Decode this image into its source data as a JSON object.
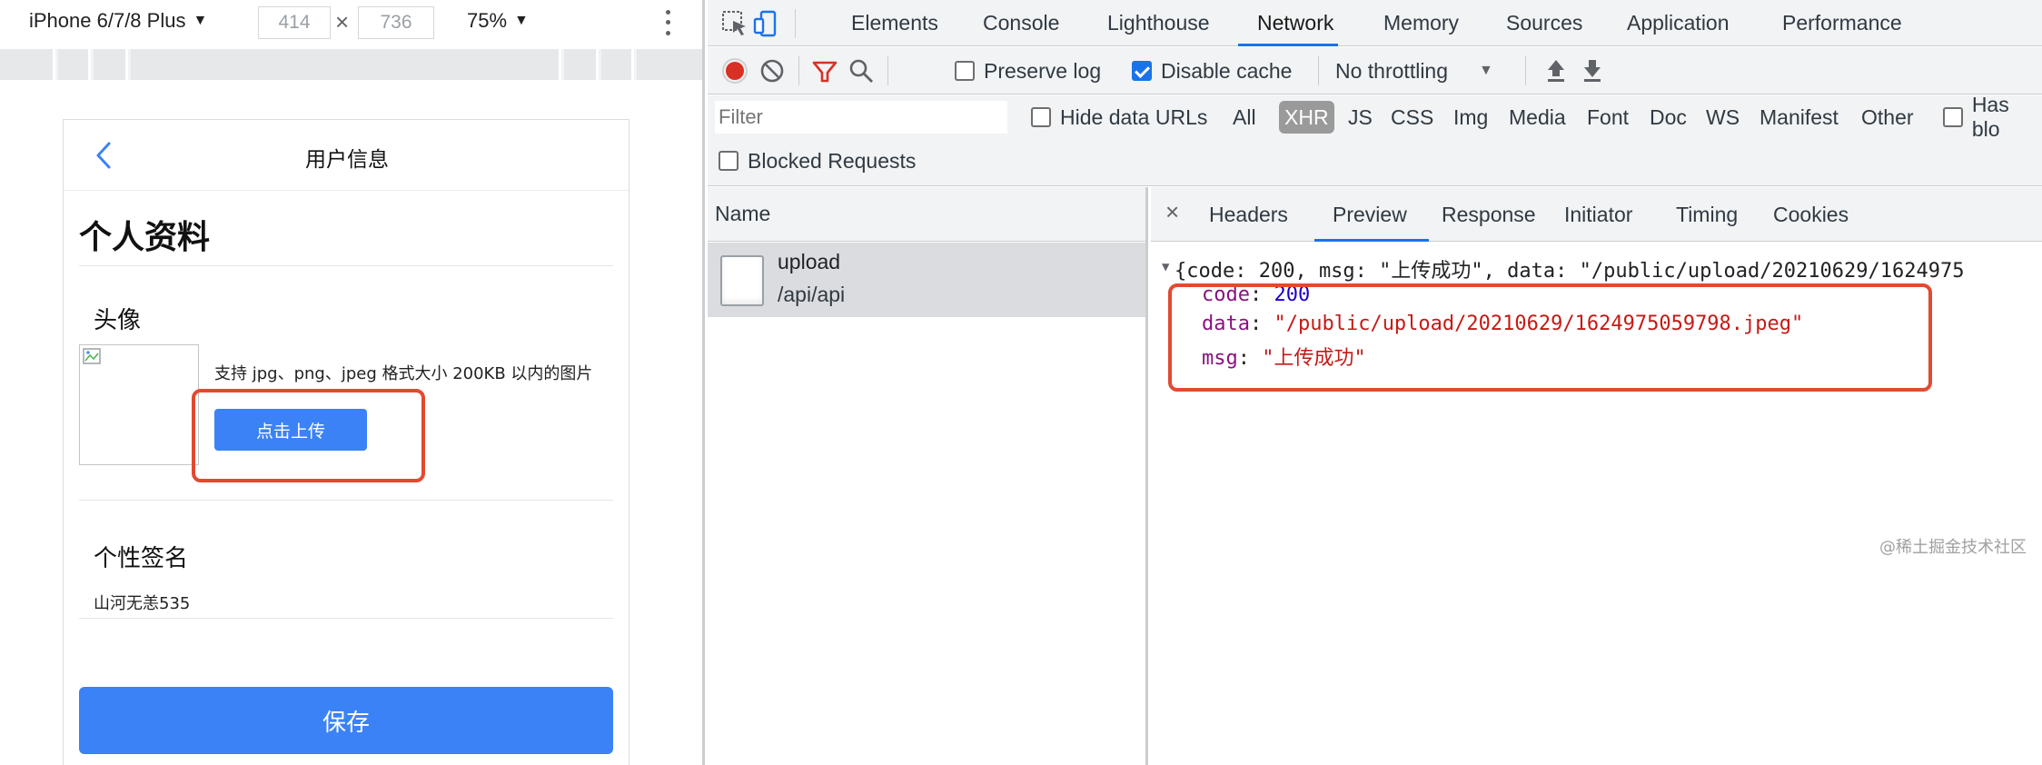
{
  "device_toolbar": {
    "device": "iPhone 6/7/8 Plus",
    "width": "414",
    "height": "736",
    "zoom": "75%"
  },
  "phone": {
    "nav_title": "用户信息",
    "section_title": "个人资料",
    "avatar_label": "头像",
    "upload_hint": "支持 jpg、png、jpeg 格式大小 200KB 以内的图片",
    "upload_button": "点击上传",
    "signature_label": "个性签名",
    "signature_value": "山河无恙535",
    "save_button": "保存"
  },
  "devtools": {
    "tabs": [
      "Elements",
      "Console",
      "Lighthouse",
      "Network",
      "Memory",
      "Sources",
      "Application",
      "Performance"
    ],
    "active_tab": "Network",
    "network_toolbar": {
      "preserve_log": "Preserve log",
      "preserve_log_checked": false,
      "disable_cache": "Disable cache",
      "disable_cache_checked": true,
      "throttling": "No throttling"
    },
    "filter": {
      "placeholder": "Filter",
      "hide_data_urls": "Hide data URLs",
      "types": [
        "All",
        "XHR",
        "JS",
        "CSS",
        "Img",
        "Media",
        "Font",
        "Doc",
        "WS",
        "Manifest",
        "Other"
      ],
      "active_type": "XHR",
      "has_blocked": "Has blo",
      "blocked_requests": "Blocked Requests"
    },
    "name_header": "Name",
    "request": {
      "name": "upload",
      "path": "/api/api"
    },
    "detail_tabs": [
      "Headers",
      "Preview",
      "Response",
      "Initiator",
      "Timing",
      "Cookies"
    ],
    "active_detail_tab": "Preview",
    "preview": {
      "summary": "{code: 200, msg: \"上传成功\", data: \"/public/upload/20210629/1624975",
      "code_key": "code",
      "code_value": "200",
      "data_key": "data",
      "data_value": "\"/public/upload/20210629/1624975059798.jpeg\"",
      "msg_key": "msg",
      "msg_value": "\"上传成功\""
    }
  },
  "watermark": "@稀土掘金技术社区",
  "colors": {
    "accent_blue": "#3b82f6",
    "devtools_blue": "#1a73e8",
    "highlight_red": "#e24a30",
    "record_red": "#d93025"
  }
}
